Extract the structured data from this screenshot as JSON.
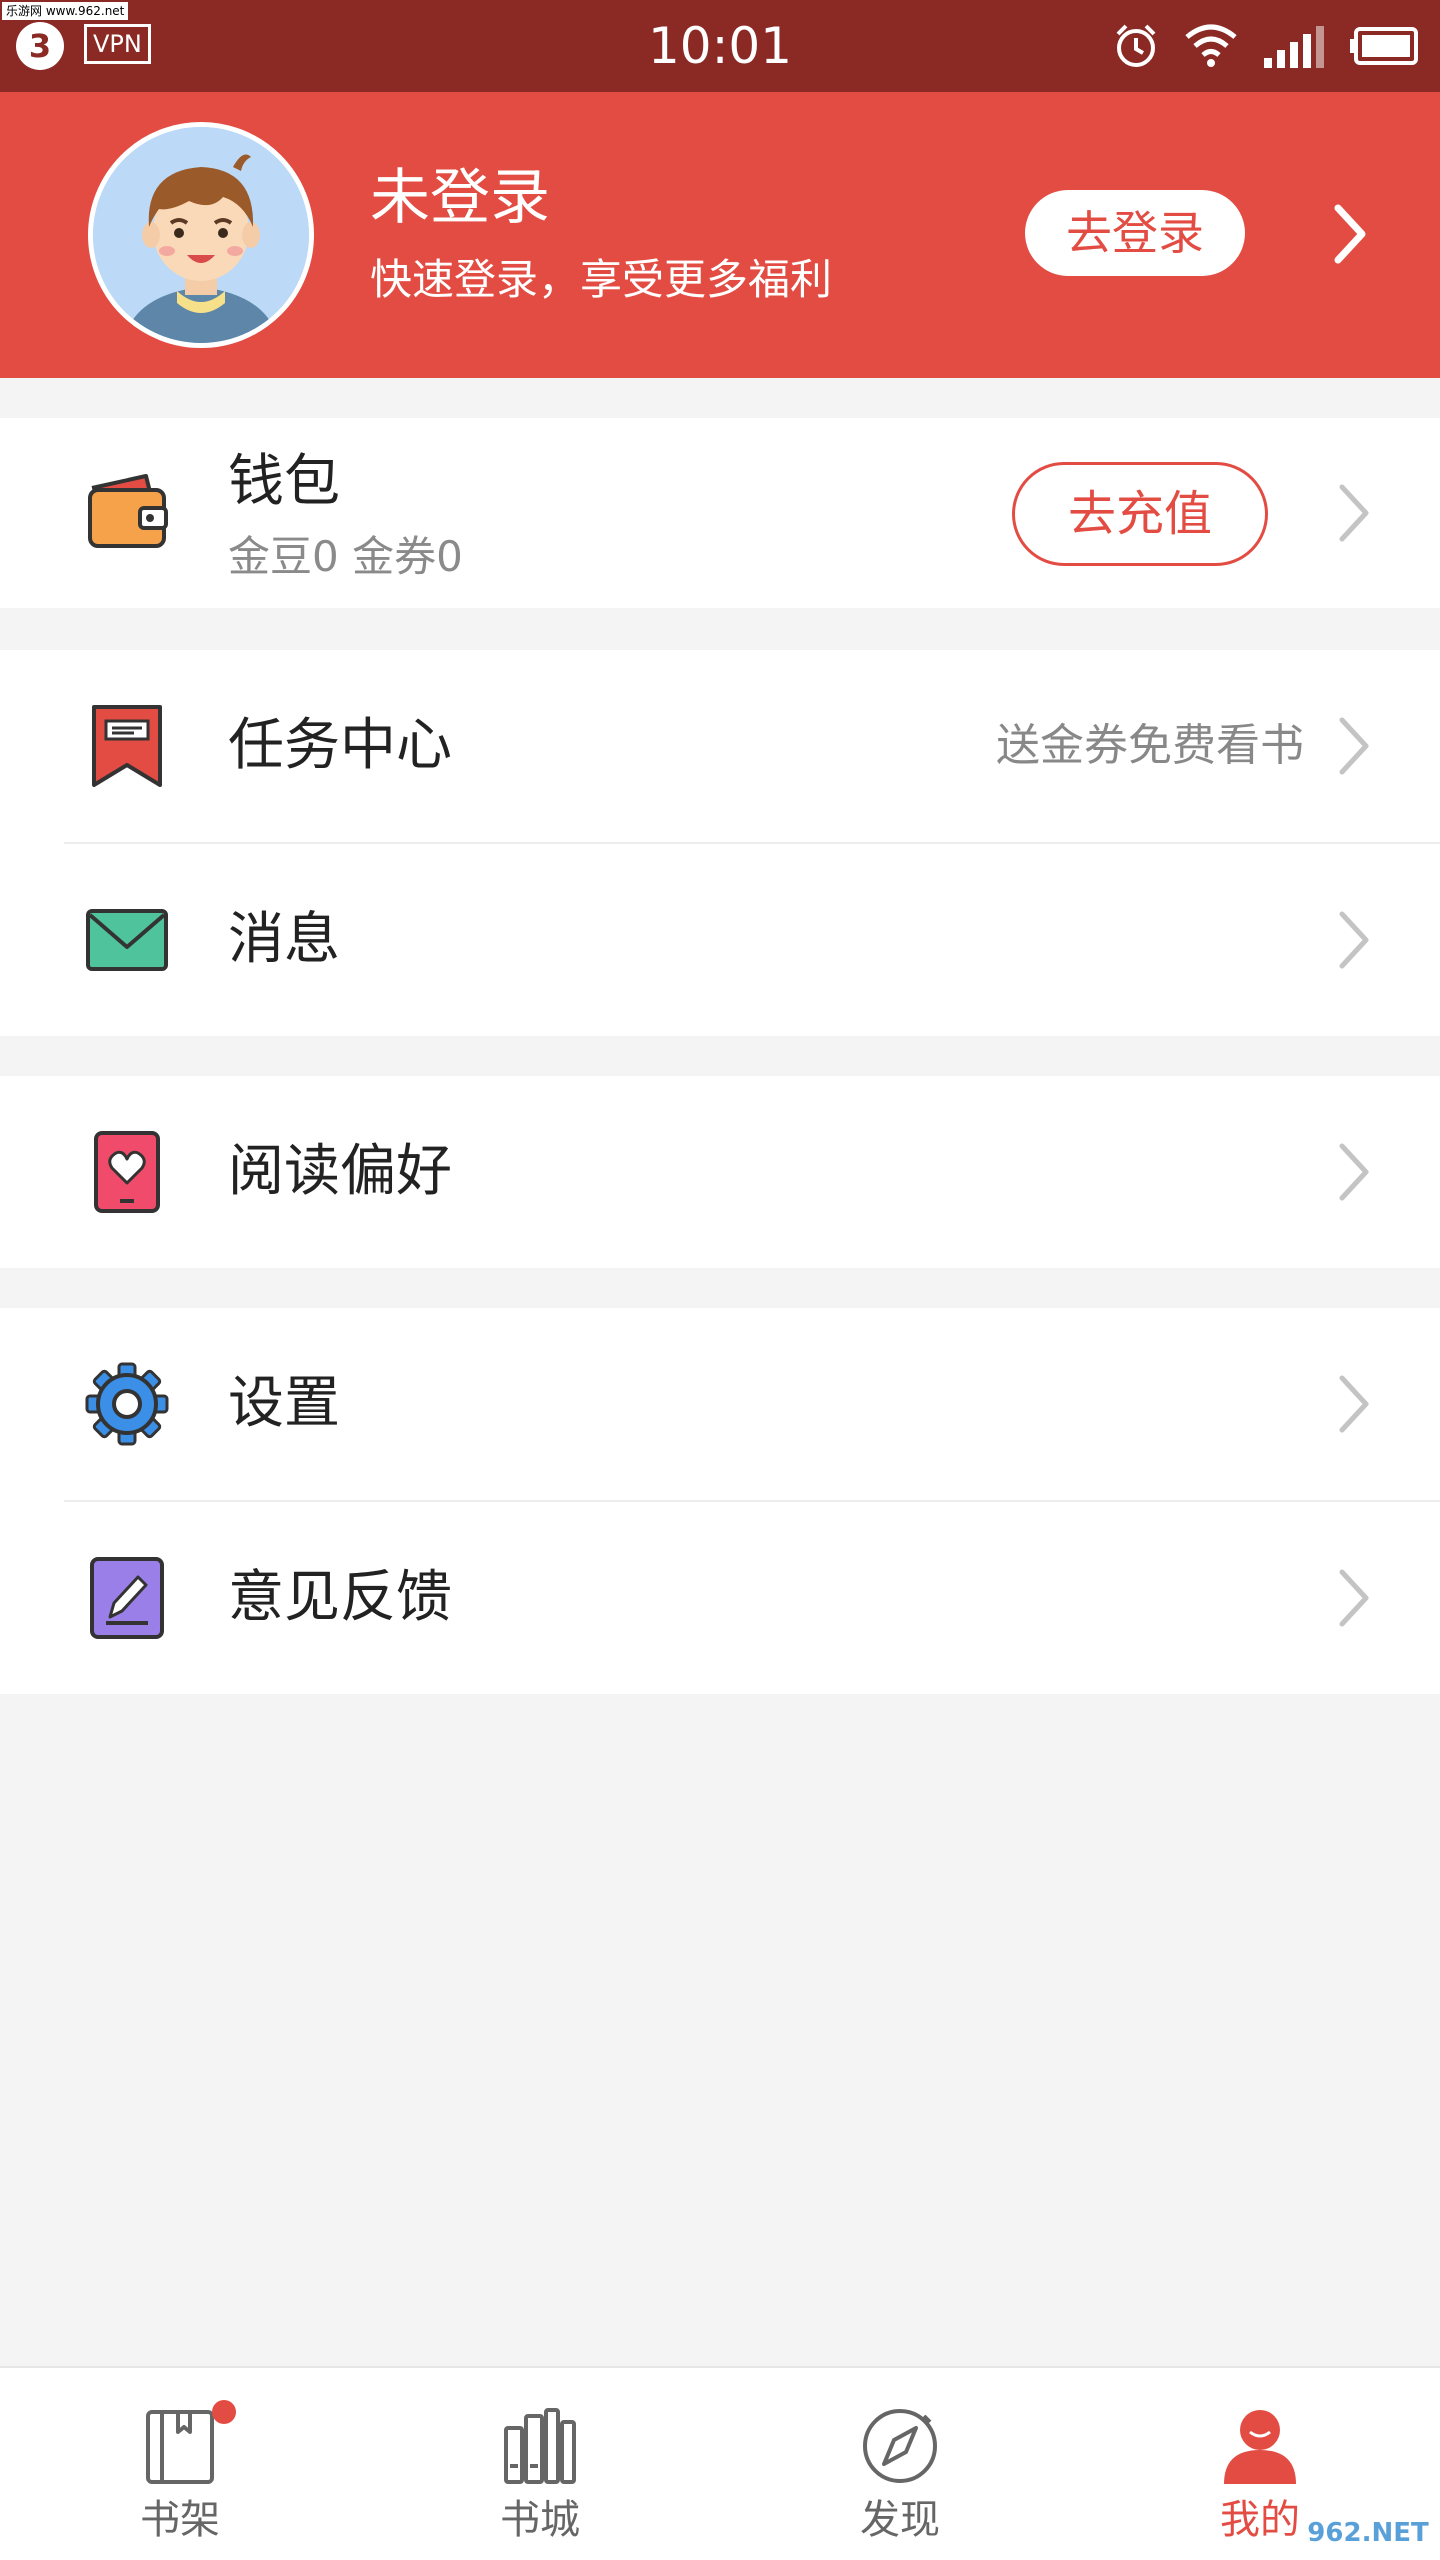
{
  "status_bar": {
    "badge": "3",
    "vpn": "VPN",
    "time": "10:01",
    "watermark": "乐游网 www.962.net"
  },
  "header": {
    "title": "未登录",
    "subtitle": "快速登录，享受更多福利",
    "login_button": "去登录"
  },
  "wallet": {
    "title": "钱包",
    "balance": "金豆0 金券0",
    "recharge_button": "去充值"
  },
  "menu": {
    "tasks": {
      "label": "任务中心",
      "hint": "送金券免费看书"
    },
    "messages": {
      "label": "消息"
    },
    "reading_prefs": {
      "label": "阅读偏好"
    },
    "settings": {
      "label": "设置"
    },
    "feedback": {
      "label": "意见反馈"
    }
  },
  "bottom_nav": {
    "items": [
      {
        "label": "书架",
        "icon": "bookshelf-icon",
        "active": false,
        "has_dot": true
      },
      {
        "label": "书城",
        "icon": "bookstore-icon",
        "active": false
      },
      {
        "label": "发现",
        "icon": "compass-icon",
        "active": false
      },
      {
        "label": "我的",
        "icon": "user-icon",
        "active": true
      }
    ]
  },
  "watermark_bottom": "962.NET",
  "colors": {
    "status_bar": "#8b2a25",
    "accent": "#e34c43",
    "background": "#f4f4f4"
  }
}
